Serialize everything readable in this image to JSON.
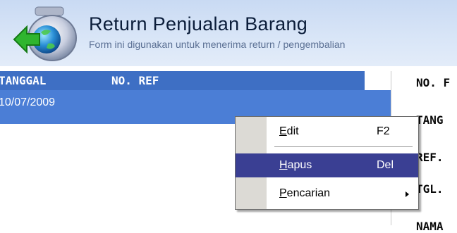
{
  "header": {
    "title": "Return Penjualan Barang",
    "subtitle": "Form ini digunakan untuk menerima return / pengembalian"
  },
  "grid": {
    "columns": [
      "TANGGAL",
      "NO. REF"
    ],
    "rows": [
      {
        "tanggal": "10/07/2009",
        "no_ref": ""
      }
    ]
  },
  "form_labels": [
    "NO. F",
    "TANG",
    "REF.",
    "TGL.",
    "NAMA"
  ],
  "context_menu": {
    "items": [
      {
        "pre": "",
        "accel": "E",
        "post": "dit",
        "shortcut": "F2",
        "highlighted": false
      },
      {
        "pre": "",
        "accel": "H",
        "post": "apus",
        "shortcut": "Del",
        "highlighted": true
      },
      {
        "pre": "",
        "accel": "P",
        "post": "encarian",
        "shortcut": "",
        "has_submenu": true,
        "highlighted": false
      }
    ]
  },
  "colors": {
    "header_bg": "#c9daf3",
    "grid_header_bg": "#3e6fc4",
    "selected_row_bg": "#4b7ed6",
    "menu_highlight": "#3a3f93"
  }
}
